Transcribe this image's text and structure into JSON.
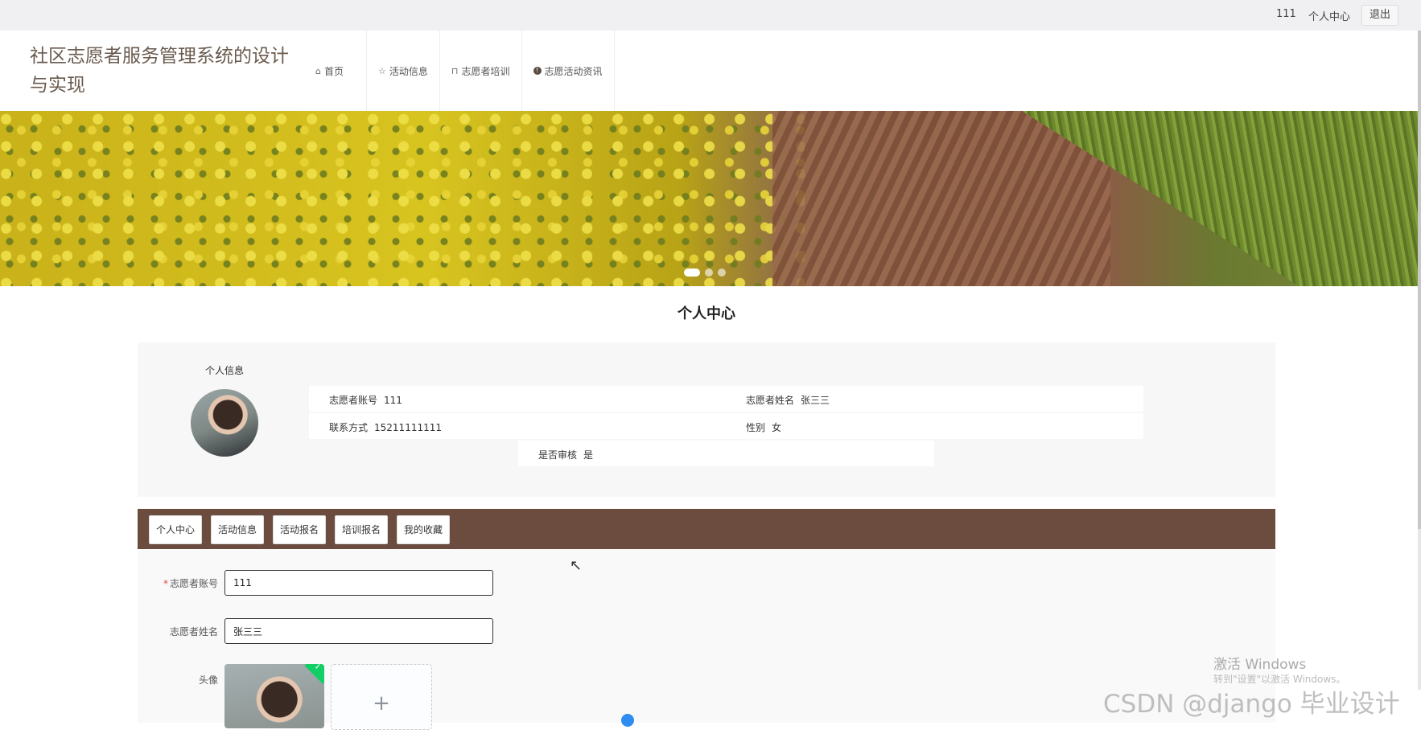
{
  "topbar": {
    "username": "111",
    "personal_center": "个人中心",
    "logout": "退出"
  },
  "header": {
    "site_title": "社区志愿者服务管理系统的设计与实现",
    "nav": [
      {
        "label": "首页",
        "icon": "home-icon"
      },
      {
        "label": "活动信息",
        "icon": "star-icon"
      },
      {
        "label": "志愿者培训",
        "icon": "bag-icon"
      },
      {
        "label": "志愿活动资讯",
        "icon": "info-icon"
      }
    ]
  },
  "carousel": {
    "slide_count": 3,
    "active_index": 0
  },
  "page_title": "个人中心",
  "profile": {
    "section_label": "个人信息",
    "fields": {
      "account_label": "志愿者账号",
      "account_value": "111",
      "name_label": "志愿者姓名",
      "name_value": "张三三",
      "phone_label": "联系方式",
      "phone_value": "15211111111",
      "gender_label": "性别",
      "gender_value": "女",
      "review_label": "是否审核",
      "review_value": "是"
    }
  },
  "tabs": [
    "个人中心",
    "活动信息",
    "活动报名",
    "培训报名",
    "我的收藏"
  ],
  "form": {
    "account_label": "志愿者账号",
    "account_value": "111",
    "name_label": "志愿者姓名",
    "name_value": "张三三",
    "avatar_label": "头像",
    "add_symbol": "+"
  },
  "watermarks": {
    "activate_title": "激活 Windows",
    "activate_sub": "转到\"设置\"以激活 Windows。",
    "csdn": "CSDN @django 毕业设计"
  },
  "colors": {
    "tabbar_bg": "#6b4c3e",
    "title_color": "#6a5a4e",
    "required": "#e64545",
    "upload_success": "#13ce66"
  }
}
